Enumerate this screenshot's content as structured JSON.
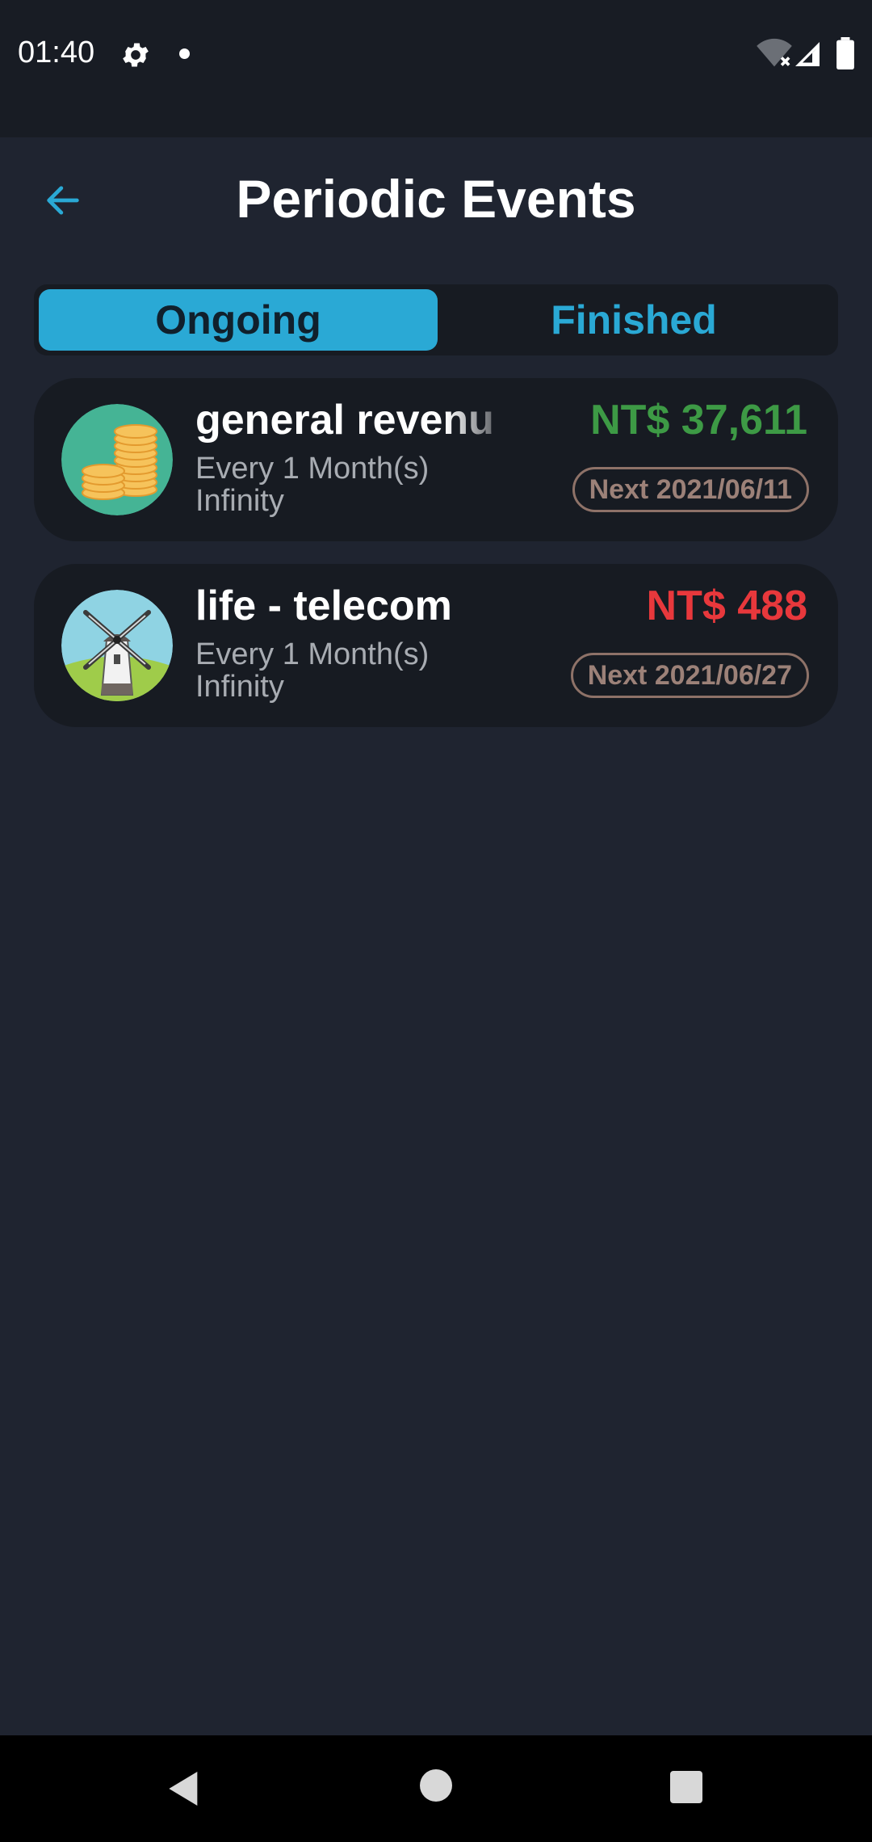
{
  "status_bar": {
    "time": "01:40",
    "icons": [
      "gear-icon",
      "notification-dot-icon",
      "wifi-off-icon",
      "signal-icon",
      "battery-icon"
    ]
  },
  "header": {
    "title": "Periodic Events",
    "back_icon": "arrow-left-icon"
  },
  "tabs": [
    {
      "label": "Ongoing",
      "selected": true
    },
    {
      "label": "Finished",
      "selected": false
    }
  ],
  "events": [
    {
      "title": "general revenu",
      "frequency": "Every 1 Month(s)",
      "repeat": "Infinity",
      "amount": "NT$ 37,611",
      "amount_type": "income",
      "amount_color": "#3d9a45",
      "next": "Next 2021/06/11",
      "icon": "coins-icon"
    },
    {
      "title": "life - telecom",
      "frequency": "Every 1 Month(s)",
      "repeat": "Infinity",
      "amount": "NT$ 488",
      "amount_type": "expense",
      "amount_color": "#e8383c",
      "next": "Next 2021/06/27",
      "icon": "windmill-icon"
    }
  ],
  "nav_bar": {
    "icons": [
      "nav-back-icon",
      "nav-home-icon",
      "nav-recents-icon"
    ]
  },
  "colors": {
    "background": "#1f2430",
    "accent": "#2aa9d5",
    "income": "#3d9a45",
    "expense": "#e8383c"
  }
}
